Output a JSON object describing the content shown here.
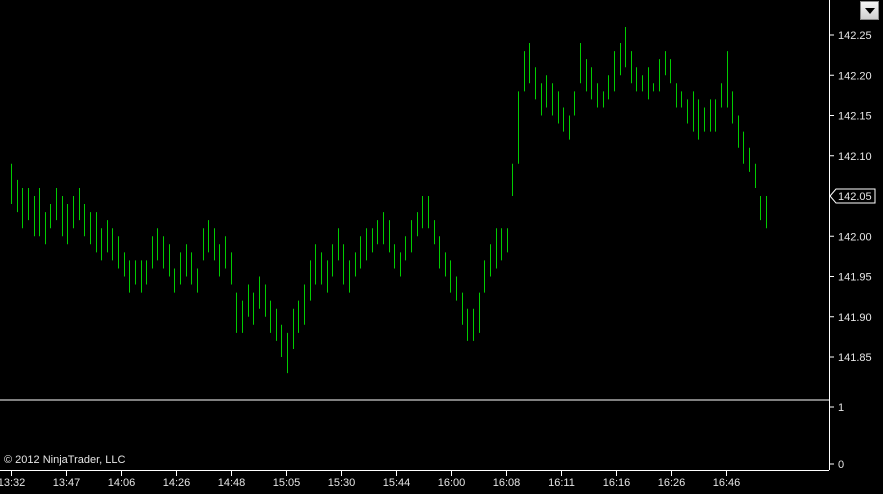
{
  "colors": {
    "background": "#000000",
    "bars": "#00cc00",
    "axis": "#ffffff",
    "text": "#e6e6e6"
  },
  "icons": {
    "menu": "chevron-down-icon"
  },
  "copyright": "© 2012 NinjaTrader, LLC",
  "chart_data": {
    "type": "ohlc",
    "title": "",
    "xlabel": "",
    "ylabel": "",
    "ylim": [
      141.81,
      142.27
    ],
    "y_ticks": [
      "142.25",
      "142.20",
      "142.15",
      "142.10",
      "142.05",
      "142.00",
      "141.95",
      "141.90",
      "141.85"
    ],
    "last_price": "142.05",
    "x_ticks": [
      "13:32",
      "13:47",
      "14:06",
      "14:26",
      "14:48",
      "15:05",
      "15:30",
      "15:44",
      "16:00",
      "16:08",
      "16:11",
      "16:16",
      "16:26",
      "16:46"
    ],
    "lower_panel": {
      "y_ticks": [
        "1",
        "0"
      ],
      "ylim": [
        0,
        1
      ]
    },
    "bars": [
      [
        142.09,
        142.04
      ],
      [
        142.07,
        142.03
      ],
      [
        142.06,
        142.01
      ],
      [
        142.06,
        142.02
      ],
      [
        142.05,
        142.0
      ],
      [
        142.06,
        142.0
      ],
      [
        142.03,
        141.99
      ],
      [
        142.04,
        142.01
      ],
      [
        142.06,
        142.02
      ],
      [
        142.05,
        142.0
      ],
      [
        142.04,
        141.99
      ],
      [
        142.05,
        142.01
      ],
      [
        142.06,
        142.02
      ],
      [
        142.04,
        142.0
      ],
      [
        142.03,
        141.99
      ],
      [
        142.03,
        141.98
      ],
      [
        142.01,
        141.97
      ],
      [
        142.02,
        141.98
      ],
      [
        142.01,
        141.97
      ],
      [
        142.0,
        141.96
      ],
      [
        141.98,
        141.95
      ],
      [
        141.97,
        141.93
      ],
      [
        141.97,
        141.94
      ],
      [
        141.97,
        141.93
      ],
      [
        141.97,
        141.94
      ],
      [
        142.0,
        141.96
      ],
      [
        142.01,
        141.97
      ],
      [
        142.0,
        141.96
      ],
      [
        141.99,
        141.95
      ],
      [
        141.96,
        141.93
      ],
      [
        141.98,
        141.94
      ],
      [
        141.99,
        141.95
      ],
      [
        141.98,
        141.94
      ],
      [
        141.96,
        141.93
      ],
      [
        142.01,
        141.97
      ],
      [
        142.02,
        141.98
      ],
      [
        142.01,
        141.97
      ],
      [
        141.99,
        141.95
      ],
      [
        142.0,
        141.96
      ],
      [
        141.98,
        141.94
      ],
      [
        141.93,
        141.88
      ],
      [
        141.92,
        141.88
      ],
      [
        141.94,
        141.9
      ],
      [
        141.93,
        141.89
      ],
      [
        141.95,
        141.91
      ],
      [
        141.94,
        141.9
      ],
      [
        141.92,
        141.88
      ],
      [
        141.91,
        141.87
      ],
      [
        141.89,
        141.85
      ],
      [
        141.88,
        141.83
      ],
      [
        141.91,
        141.86
      ],
      [
        141.92,
        141.88
      ],
      [
        141.94,
        141.89
      ],
      [
        141.97,
        141.92
      ],
      [
        141.99,
        141.94
      ],
      [
        141.98,
        141.94
      ],
      [
        141.97,
        141.93
      ],
      [
        141.99,
        141.95
      ],
      [
        142.01,
        141.97
      ],
      [
        141.99,
        141.94
      ],
      [
        141.97,
        141.93
      ],
      [
        141.98,
        141.95
      ],
      [
        142.0,
        141.96
      ],
      [
        142.01,
        141.97
      ],
      [
        142.01,
        141.98
      ],
      [
        142.02,
        141.99
      ],
      [
        142.03,
        141.99
      ],
      [
        142.02,
        141.98
      ],
      [
        141.99,
        141.96
      ],
      [
        141.98,
        141.95
      ],
      [
        142.0,
        141.97
      ],
      [
        142.02,
        141.98
      ],
      [
        142.03,
        142.0
      ],
      [
        142.05,
        142.01
      ],
      [
        142.05,
        142.01
      ],
      [
        142.02,
        141.99
      ],
      [
        142.0,
        141.96
      ],
      [
        141.98,
        141.95
      ],
      [
        141.97,
        141.93
      ],
      [
        141.95,
        141.92
      ],
      [
        141.93,
        141.89
      ],
      [
        141.91,
        141.87
      ],
      [
        141.91,
        141.87
      ],
      [
        141.93,
        141.88
      ],
      [
        141.97,
        141.93
      ],
      [
        141.99,
        141.95
      ],
      [
        142.01,
        141.96
      ],
      [
        142.01,
        141.97
      ],
      [
        142.01,
        141.98
      ],
      [
        142.09,
        142.05
      ],
      [
        142.18,
        142.09
      ],
      [
        142.23,
        142.18
      ],
      [
        142.24,
        142.19
      ],
      [
        142.21,
        142.17
      ],
      [
        142.19,
        142.15
      ],
      [
        142.2,
        142.16
      ],
      [
        142.19,
        142.15
      ],
      [
        142.18,
        142.14
      ],
      [
        142.16,
        142.13
      ],
      [
        142.15,
        142.12
      ],
      [
        142.18,
        142.15
      ],
      [
        142.24,
        142.19
      ],
      [
        142.22,
        142.18
      ],
      [
        142.21,
        142.17
      ],
      [
        142.19,
        142.16
      ],
      [
        142.18,
        142.16
      ],
      [
        142.2,
        142.17
      ],
      [
        142.23,
        142.18
      ],
      [
        142.24,
        142.2
      ],
      [
        142.26,
        142.21
      ],
      [
        142.23,
        142.19
      ],
      [
        142.21,
        142.18
      ],
      [
        142.2,
        142.18
      ],
      [
        142.21,
        142.17
      ],
      [
        142.19,
        142.18
      ],
      [
        142.22,
        142.18
      ],
      [
        142.23,
        142.2
      ],
      [
        142.22,
        142.19
      ],
      [
        142.19,
        142.16
      ],
      [
        142.18,
        142.16
      ],
      [
        142.17,
        142.14
      ],
      [
        142.18,
        142.13
      ],
      [
        142.17,
        142.12
      ],
      [
        142.16,
        142.13
      ],
      [
        142.17,
        142.13
      ],
      [
        142.17,
        142.13
      ],
      [
        142.19,
        142.16
      ],
      [
        142.23,
        142.16
      ],
      [
        142.18,
        142.14
      ],
      [
        142.15,
        142.11
      ],
      [
        142.13,
        142.09
      ],
      [
        142.11,
        142.08
      ],
      [
        142.09,
        142.06
      ],
      [
        142.05,
        142.02
      ],
      [
        142.05,
        142.01
      ]
    ]
  }
}
